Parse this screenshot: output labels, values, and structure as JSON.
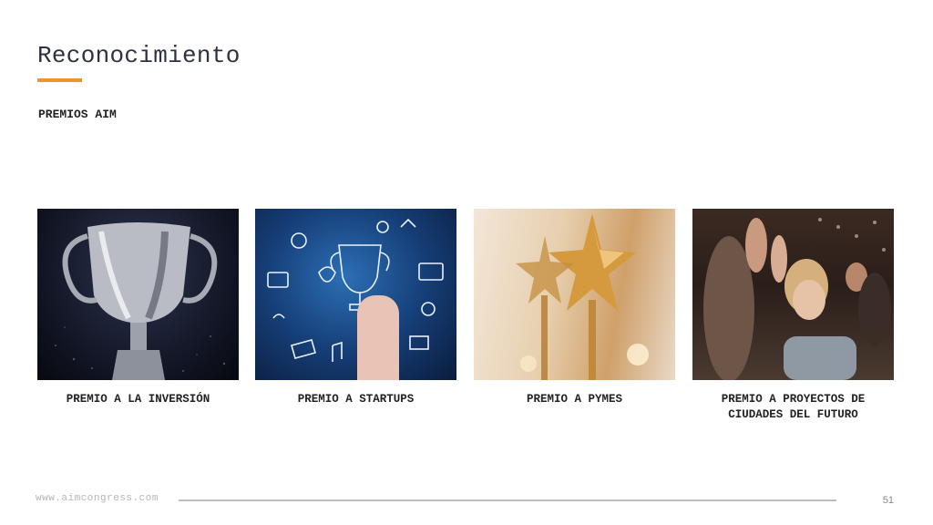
{
  "slide": {
    "title": "Reconocimiento",
    "subtitle": "PREMIOS AIM",
    "accent_color": "#f0932b"
  },
  "awards": [
    {
      "caption": "PREMIO A LA INVERSIÓN",
      "image": "trophy-cup-photo"
    },
    {
      "caption": "PREMIO A STARTUPS",
      "image": "hand-holding-drawn-trophy-photo"
    },
    {
      "caption": "PREMIO A PYMES",
      "image": "gold-star-trophies-photo"
    },
    {
      "caption": "PREMIO A PROYECTOS DE CIUDADES DEL FUTURO",
      "image": "applauding-audience-photo"
    }
  ],
  "footer": {
    "url": "www.aimcongress.com",
    "page_number": "51"
  }
}
